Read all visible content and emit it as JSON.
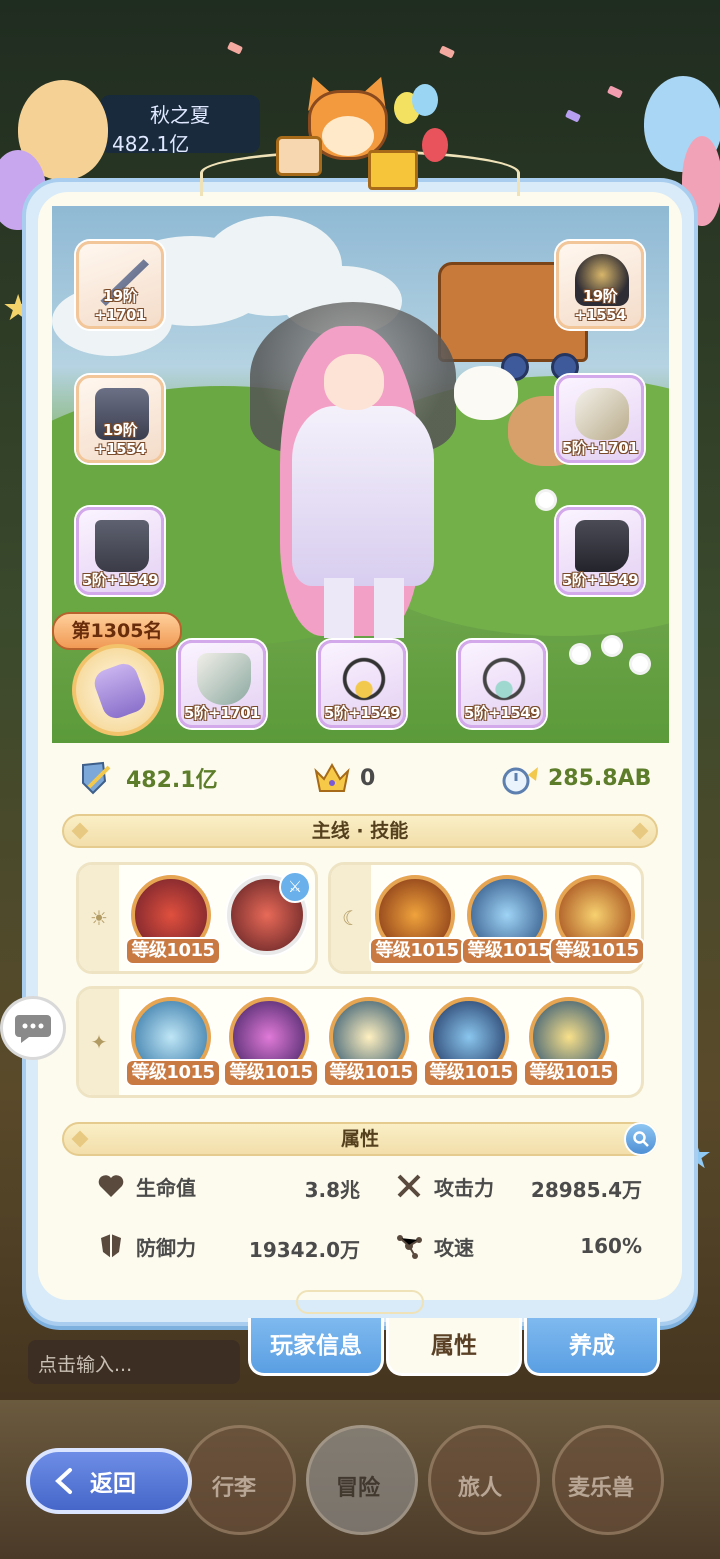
{
  "background": {
    "player_name": "秋之夏",
    "player_power": "482.1亿"
  },
  "equipment": {
    "left": [
      {
        "label": "19阶+1701",
        "icon": "bow-icon"
      },
      {
        "label": "19阶+1554",
        "icon": "armor-icon"
      },
      {
        "label": "5阶+1549",
        "icon": "pants-icon"
      }
    ],
    "right": [
      {
        "label": "19阶+1554",
        "icon": "helmet-icon"
      },
      {
        "label": "5阶+1701",
        "icon": "gauntlet-icon"
      },
      {
        "label": "5阶+1549",
        "icon": "boots-icon"
      }
    ],
    "bottom": [
      {
        "label": "5阶+1701",
        "icon": "shield-icon"
      },
      {
        "label": "5阶+1549",
        "icon": "necklace-icon"
      },
      {
        "label": "5阶+1549",
        "icon": "amulet-icon"
      }
    ],
    "rank": "第1305名"
  },
  "stats": {
    "power": "482.1亿",
    "crown": "0",
    "speed": "285.8AB"
  },
  "skills": {
    "title": "主线 · 技能",
    "group_sun": [
      "等级1015"
    ],
    "group_moon": [
      "等级1015",
      "等级1015",
      "等级1015"
    ],
    "group_star": [
      "等级1015",
      "等级1015",
      "等级1015",
      "等级1015",
      "等级1015"
    ]
  },
  "attributes": {
    "title": "属性",
    "hp_label": "生命值",
    "hp_value": "3.8兆",
    "atk_label": "攻击力",
    "atk_value": "28985.4万",
    "def_label": "防御力",
    "def_value": "19342.0万",
    "aspd_label": "攻速",
    "aspd_value": "160%"
  },
  "tabs": [
    "玩家信息",
    "属性",
    "养成"
  ],
  "active_tab": "属性",
  "chat": {
    "placeholder": "点击输入..."
  },
  "nav": [
    "行李",
    "冒险",
    "旅人",
    "麦乐兽"
  ],
  "back_label": "返回",
  "colors": {
    "panel_border": "#a8cdee",
    "panel_bg": "#fdfbee",
    "tab_blue": "#5a9fe3",
    "skill_level_bg": "#c87a42",
    "stat_green": "#5d7d2a"
  }
}
